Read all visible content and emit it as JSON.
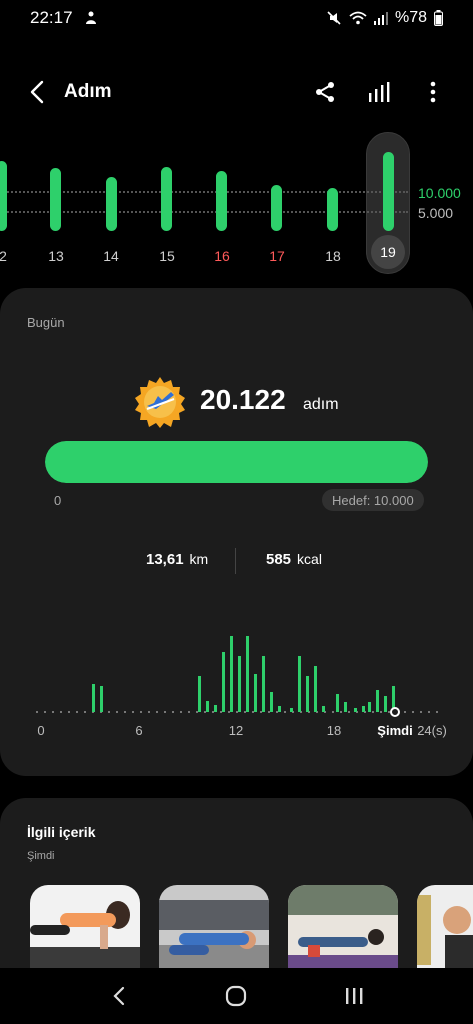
{
  "status": {
    "time": "22:17",
    "battery": "%78"
  },
  "header": {
    "title": "Adım"
  },
  "strip": {
    "days": [
      "2",
      "13",
      "14",
      "15",
      "16",
      "17",
      "18",
      "19"
    ],
    "weekend_days": [
      "16",
      "17"
    ],
    "selected_day": "19",
    "goal_top_label": "10.000",
    "goal_bottom_label": "5.000"
  },
  "today": {
    "label": "Bugün",
    "steps": "20.122",
    "steps_unit": "adım",
    "progress_fraction": 1.0,
    "progress_start": "0",
    "goal": "Hedef: 10.000",
    "distance_value": "13,61",
    "distance_unit": "km",
    "calories_value": "585",
    "calories_unit": "kcal",
    "hourly_axis": [
      "0",
      "6",
      "12",
      "18",
      "Şimdi",
      "24(s)"
    ]
  },
  "related": {
    "title": "İlgili içerik",
    "subtitle": "Şimdi"
  },
  "colors": {
    "accent": "#2ed06b",
    "weekend": "#ff5a5a",
    "card": "#1c1c1c"
  }
}
